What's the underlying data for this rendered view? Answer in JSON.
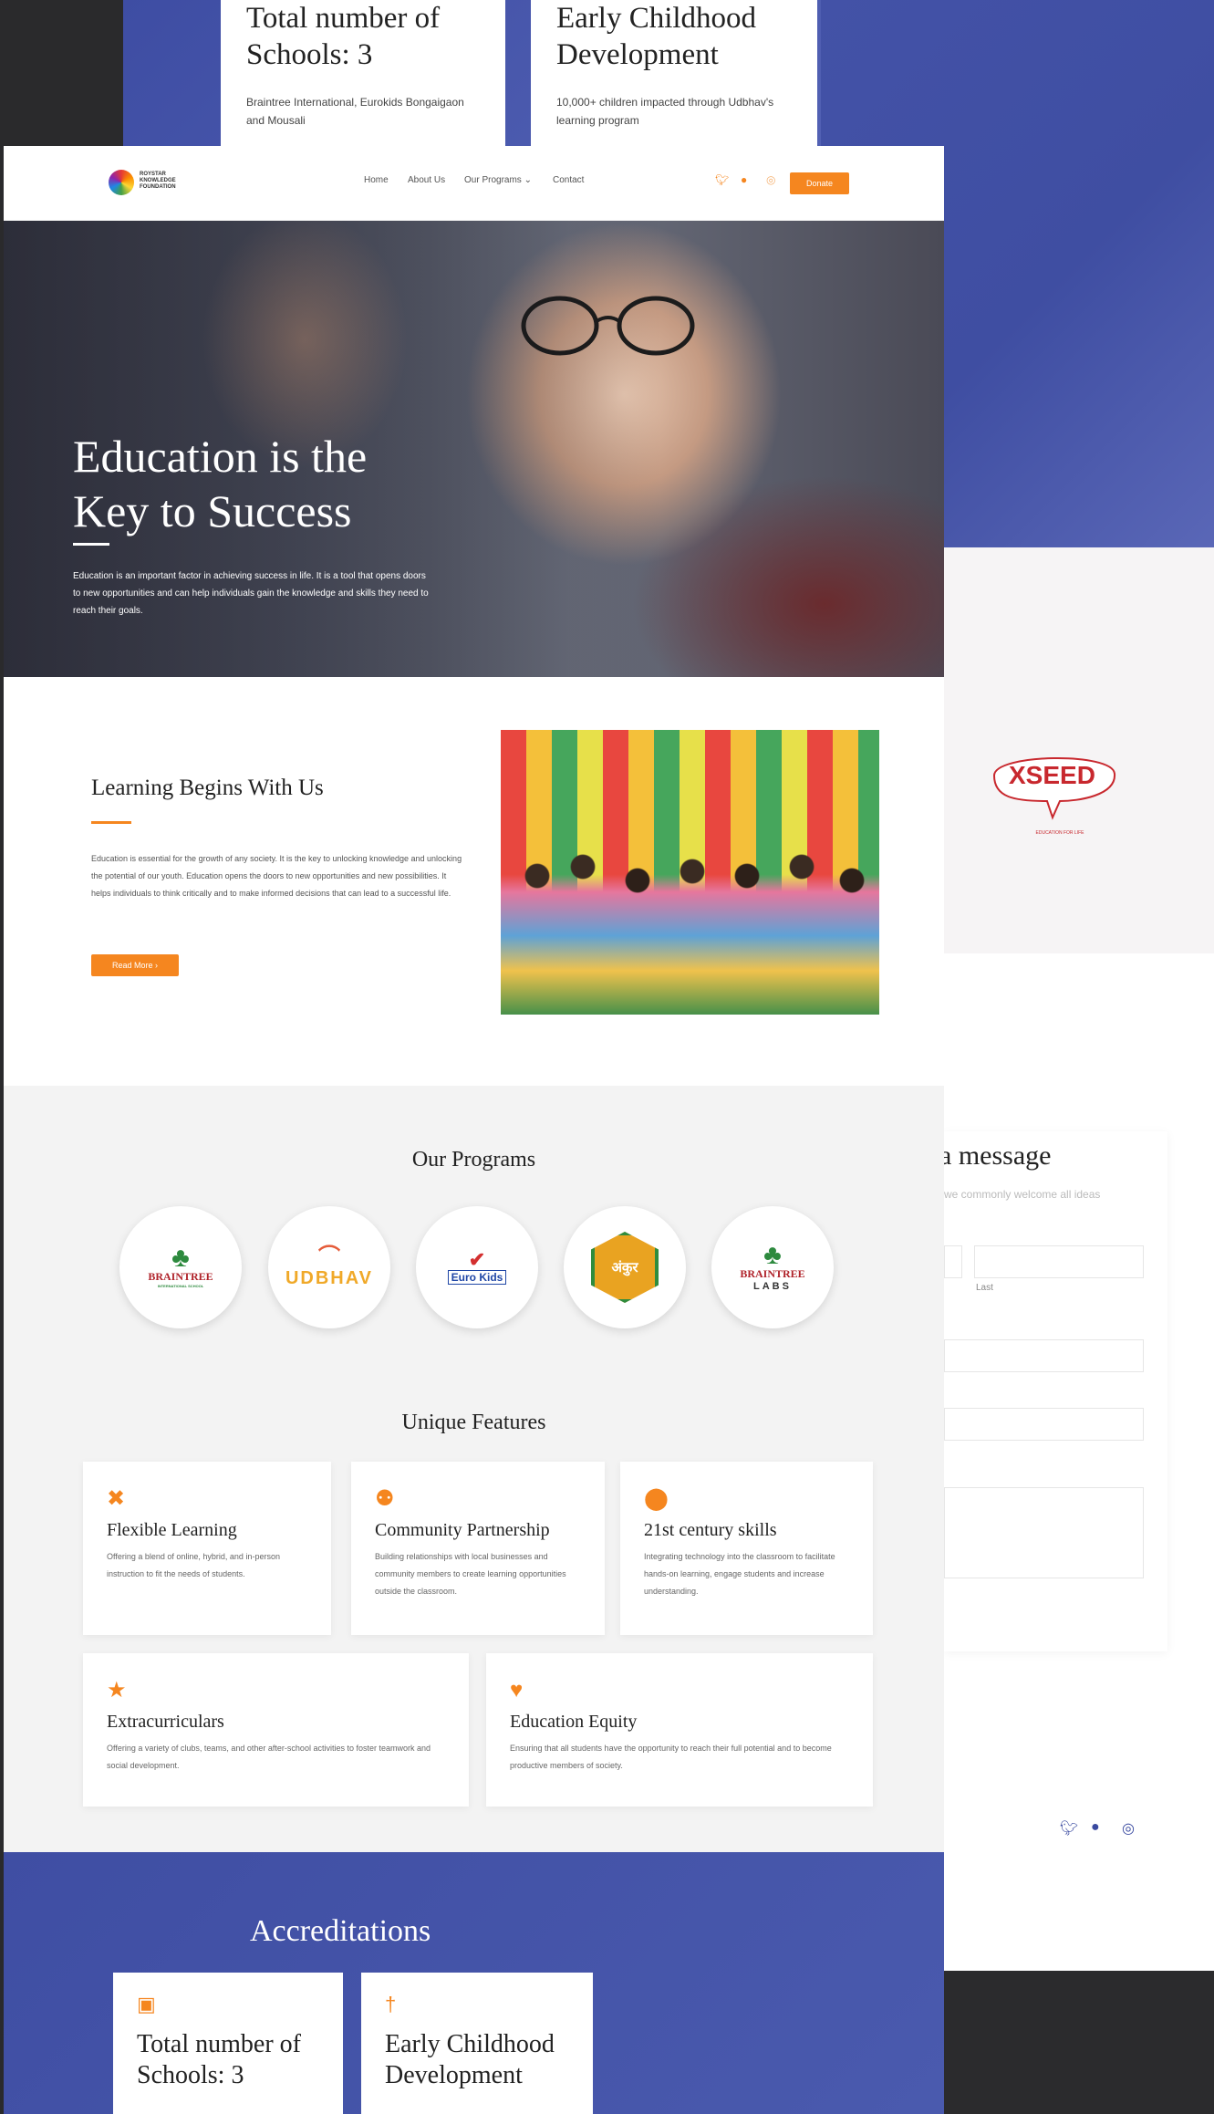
{
  "top_cards": [
    {
      "title": "Total number of Schools: 3",
      "desc": "Braintree International, Eurokids Bongaigaon and Mousali"
    },
    {
      "title": "Early Childhood Development",
      "desc": "10,000+ children impacted through Udbhav's learning program"
    }
  ],
  "nav": {
    "logo_text": "ROYSTAR KNOWLEDGE FOUNDATION",
    "items": [
      "Home",
      "About Us",
      "Our Programs",
      "Contact"
    ],
    "donate": "Donate",
    "social_icons": [
      "twitter-icon",
      "github-icon",
      "instagram-icon"
    ]
  },
  "hero": {
    "title_line1": "Education is the",
    "title_line2": "Key to Success",
    "text": "Education is an important factor in achieving success in life. It is a tool that opens doors to new opportunities and can help individuals gain the knowledge and skills they need to reach their goals."
  },
  "learning": {
    "title": "Learning Begins With Us",
    "text": "Education is essential for the growth of any society. It is the key to unlocking knowledge and unlocking the potential of our youth. Education opens the doors to new opportunities and new possibilities. It helps individuals to think critically and to make informed decisions that can lead to a successful life.",
    "button": "Read More"
  },
  "programs": {
    "title": "Our Programs",
    "logos": [
      {
        "name": "BRAINTREE",
        "sub": "INTERNATIONAL SCHOOL"
      },
      {
        "name": "UDBHAV",
        "sub": ""
      },
      {
        "name": "Euro Kids",
        "sub": ""
      },
      {
        "name": "अंकुर",
        "sub": ""
      },
      {
        "name": "BRAINTREE",
        "sub": "LABS"
      }
    ]
  },
  "features": {
    "title": "Unique Features",
    "items": [
      {
        "icon": "arrows-icon",
        "title": "Flexible Learning",
        "desc": "Offering a blend of online, hybrid, and in-person instruction to fit the needs of students."
      },
      {
        "icon": "people-icon",
        "title": "Community Partnership",
        "desc": "Building relationships with local businesses and community members to create learning opportunities outside the classroom."
      },
      {
        "icon": "brain-icon",
        "title": "21st century skills",
        "desc": "Integrating technology into the classroom to facilitate hands-on learning, engage students and increase understanding."
      },
      {
        "icon": "running-icon",
        "title": "Extracurriculars",
        "desc": "Offering a variety of clubs, teams, and other after-school activities to foster teamwork and social development."
      },
      {
        "icon": "hand-heart-icon",
        "title": "Education Equity",
        "desc": "Ensuring that all students have the opportunity to reach their full potential and to become productive members of society."
      }
    ]
  },
  "accreditations": {
    "title": "Accreditations",
    "cards": [
      {
        "icon": "building-icon",
        "title": "Total number of Schools: 3"
      },
      {
        "icon": "child-icon",
        "title": "Early Childhood Development"
      }
    ]
  },
  "right": {
    "xseed": "XSEED",
    "xseed_sub": "EDUCATION FOR LIFE",
    "message_title": "a message",
    "message_sub": "we commonly welcome all ideas",
    "last_label": "Last"
  },
  "colors": {
    "accent": "#f5861f",
    "blue": "#4050a5"
  }
}
